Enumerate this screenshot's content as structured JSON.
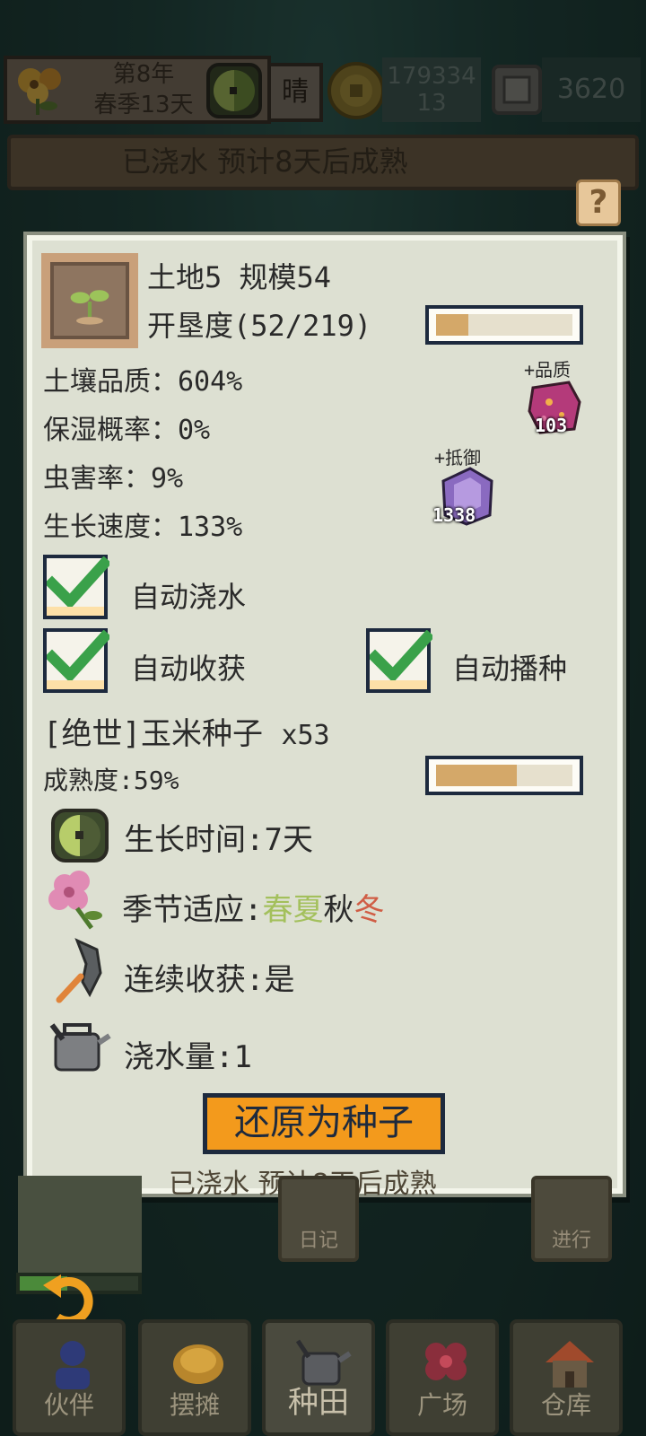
{
  "status_bar": {
    "year": "第8年",
    "season_day": "春季13天",
    "weather": "晴",
    "coins_line1": "179334",
    "coins_line2": "13",
    "gems": "3620"
  },
  "behind_banner": "已浇水 预计8天后成熟",
  "help_label": "?",
  "plot": {
    "title": "土地5 规模54",
    "reclaim_label": "开垦度(52/219)",
    "reclaim_progress": 0.237,
    "stats": [
      {
        "label": "土壤品质：604%"
      },
      {
        "label": "保湿概率：0%"
      },
      {
        "label": "虫害率：9%"
      },
      {
        "label": "生长速度：133%"
      }
    ],
    "quality_gem": {
      "caption": "+品质",
      "count": "103",
      "color": "#b43a7a"
    },
    "defense_gem": {
      "caption": "+抵御",
      "count": "1338",
      "color": "#8a6ac0"
    }
  },
  "toggles": {
    "auto_water": {
      "label": "自动浇水",
      "checked": true
    },
    "auto_harvest": {
      "label": "自动收获",
      "checked": true
    },
    "auto_sow": {
      "label": "自动播种",
      "checked": true
    }
  },
  "seed": {
    "name": "[绝世]玉米种子",
    "quantity": "x53",
    "maturity_label": "成熟度:59%",
    "maturity_progress": 0.59,
    "growth_time": "生长时间:7天",
    "season_prefix": "季节适应:",
    "seasons": [
      "春",
      "夏",
      "秋",
      "冬"
    ],
    "continuous": "连续收获:是",
    "water_amount": "浇水量:1"
  },
  "restore_button": "还原为种子",
  "lower_banner": "已浇水 预计8天后成熟",
  "side_buttons": {
    "diary": "日记",
    "proceed": "进行"
  },
  "nav": [
    {
      "label": "伙伴",
      "icon": "partner-icon"
    },
    {
      "label": "摆摊",
      "icon": "stall-icon"
    },
    {
      "label": "种田",
      "icon": "watering-can-icon"
    },
    {
      "label": "广场",
      "icon": "flower-icon"
    },
    {
      "label": "仓库",
      "icon": "house-icon"
    }
  ],
  "colors": {
    "accent_button": "#f39a1c",
    "progress_fill": "#d4a869",
    "check_green": "#3aa14a",
    "spring_summer": "#a3c05c",
    "winter": "#d05d45"
  }
}
